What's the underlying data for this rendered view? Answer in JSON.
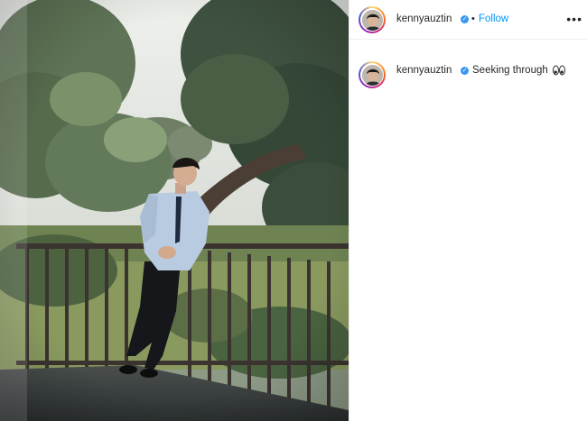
{
  "post": {
    "author": {
      "username": "kennyauztin",
      "verified_icon": "verified-badge-icon",
      "separator": "•",
      "follow_label": "Follow"
    },
    "more_label": "•••",
    "caption": {
      "username": "kennyauztin",
      "text": "Seeking through",
      "emoji": "eyes-emoji-icon"
    },
    "colors": {
      "link": "#0095f6",
      "verified": "#3897f0",
      "text": "#262626"
    }
  }
}
